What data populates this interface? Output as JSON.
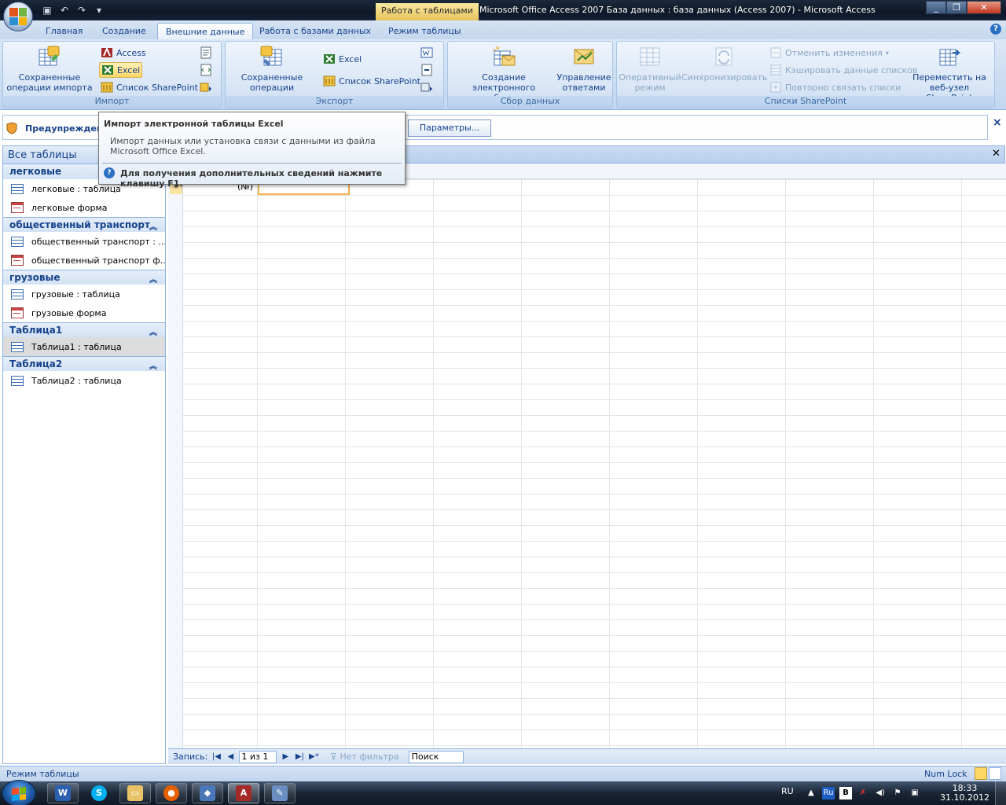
{
  "titlebar": {
    "context_tab": "Работа с таблицами",
    "title": "Microsoft Office Access 2007 База данных : база данных (Access 2007) - Microsoft Access",
    "qat_icons": [
      "save-icon",
      "undo-icon",
      "redo-icon",
      "customize-qat-icon"
    ]
  },
  "tabs": [
    {
      "label": "Главная",
      "active": false
    },
    {
      "label": "Создание",
      "active": false
    },
    {
      "label": "Внешние данные",
      "active": true
    },
    {
      "label": "Работа с базами данных",
      "active": false
    },
    {
      "label": "Режим таблицы",
      "active": false
    }
  ],
  "ribbon": {
    "import": {
      "label": "Импорт",
      "saved_imports": "Сохраненные операции импорта",
      "access": "Access",
      "excel": "Excel",
      "sharepoint": "Список SharePoint"
    },
    "export": {
      "label": "Экспорт",
      "saved_exports": "Сохраненные операции экспорта",
      "excel": "Excel",
      "sharepoint": "Список SharePoint"
    },
    "collect": {
      "label": "Сбор данных",
      "create_email": "Создание электронного сообщения",
      "manage_replies": "Управление ответами"
    },
    "sharepoint": {
      "label": "Списки SharePoint",
      "offline": "Оперативный режим",
      "sync": "Синхронизировать",
      "discard": "Отменить изменения",
      "cache": "Кэшировать данные списков",
      "relink": "Повторно связать списки",
      "move": "Переместить на веб-узел SharePoint"
    }
  },
  "msgbar": {
    "text": "Предупреждение",
    "options_label": "Параметры...",
    "close": "×"
  },
  "tooltip": {
    "title": "Импорт электронной таблицы Excel",
    "body": "Импорт данных или установка связи с данными из файла Microsoft Office Excel.",
    "help": "Для получения дополнительных сведений нажмите клавишу F1."
  },
  "nav": {
    "header": "Все таблицы",
    "groups": [
      {
        "name": "легковые",
        "items": [
          {
            "label": "легковые : таблица",
            "type": "table"
          },
          {
            "label": "легковые форма",
            "type": "form"
          }
        ]
      },
      {
        "name": "общественный транспорт",
        "items": [
          {
            "label": "общественный транспорт : ...",
            "type": "table"
          },
          {
            "label": "общественный транспорт ф...",
            "type": "form"
          }
        ]
      },
      {
        "name": "грузовые",
        "items": [
          {
            "label": "грузовые : таблица",
            "type": "table"
          },
          {
            "label": "грузовые форма",
            "type": "form"
          }
        ]
      },
      {
        "name": "Таблица1",
        "items": [
          {
            "label": "Таблица1 : таблица",
            "type": "table",
            "selected": true
          }
        ]
      },
      {
        "name": "Таблица2",
        "items": [
          {
            "label": "Таблица2 : таблица",
            "type": "table"
          }
        ]
      }
    ]
  },
  "grid": {
    "new_row_marker": "*",
    "num_cell": "(№)"
  },
  "recnav": {
    "label": "Запись:",
    "current": "1 из 1",
    "nofilter": "Нет фильтра",
    "search": "Поиск"
  },
  "status": {
    "text": "Режим таблицы",
    "numlock": "Num Lock"
  },
  "taskbar": {
    "lang": "RU",
    "time": "18:33",
    "date": "31.10.2012",
    "lang_indicator": "Ru"
  }
}
